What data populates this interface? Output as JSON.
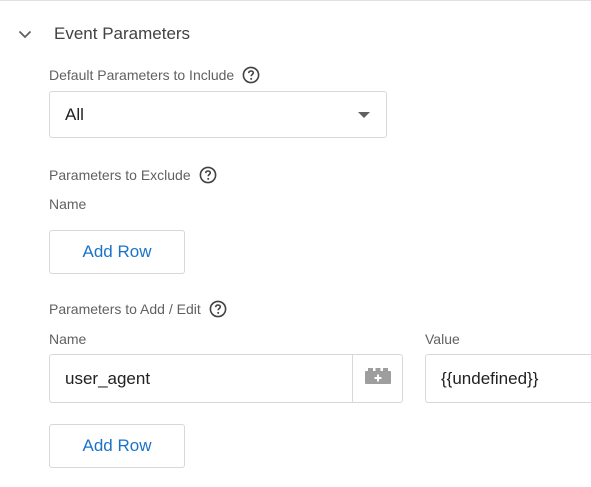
{
  "section": {
    "title": "Event Parameters"
  },
  "default_params": {
    "label": "Default Parameters to Include",
    "selected": "All"
  },
  "exclude": {
    "label": "Parameters to Exclude",
    "name_label": "Name",
    "add_row_label": "Add Row"
  },
  "add_edit": {
    "label": "Parameters to Add / Edit",
    "name_label": "Name",
    "value_label": "Value",
    "rows": [
      {
        "name": "user_agent",
        "value": "{{undefined}}"
      }
    ],
    "add_row_label": "Add Row"
  },
  "icons": {
    "collapse": "chevron-down-icon",
    "help": "help-circle-icon",
    "variable": "variable-brick-icon"
  },
  "colors": {
    "accent": "#1a73c8",
    "border": "#d8d8d8",
    "label": "#616161"
  }
}
